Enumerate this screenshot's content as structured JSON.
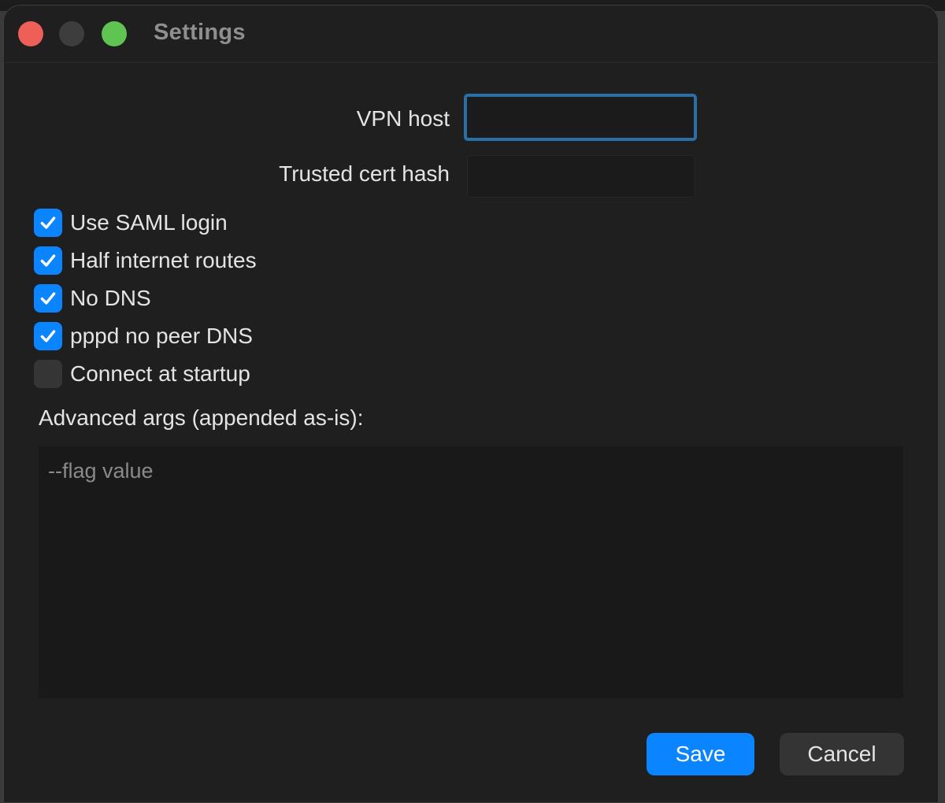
{
  "window": {
    "title": "Settings"
  },
  "form": {
    "vpn_host": {
      "label": "VPN host",
      "value": ""
    },
    "trusted_cert_hash": {
      "label": "Trusted cert hash",
      "value": ""
    }
  },
  "options": [
    {
      "label": "Use SAML login",
      "checked": true
    },
    {
      "label": "Half internet routes",
      "checked": true
    },
    {
      "label": "No DNS",
      "checked": true
    },
    {
      "label": "pppd no peer DNS",
      "checked": true
    },
    {
      "label": "Connect at startup",
      "checked": false
    }
  ],
  "advanced": {
    "label": "Advanced args (appended as-is):",
    "placeholder": "--flag value",
    "value": ""
  },
  "buttons": {
    "save_label": "Save",
    "cancel_label": "Cancel"
  },
  "colors": {
    "accent": "#0a84ff",
    "focus_ring": "#2a6fa8",
    "close": "#ed5f57",
    "minimize_inactive": "#3d3d3d",
    "zoom": "#5fc451",
    "window_bg": "#1f1f1f"
  },
  "icons": {
    "checkmark": "checkmark-icon"
  }
}
